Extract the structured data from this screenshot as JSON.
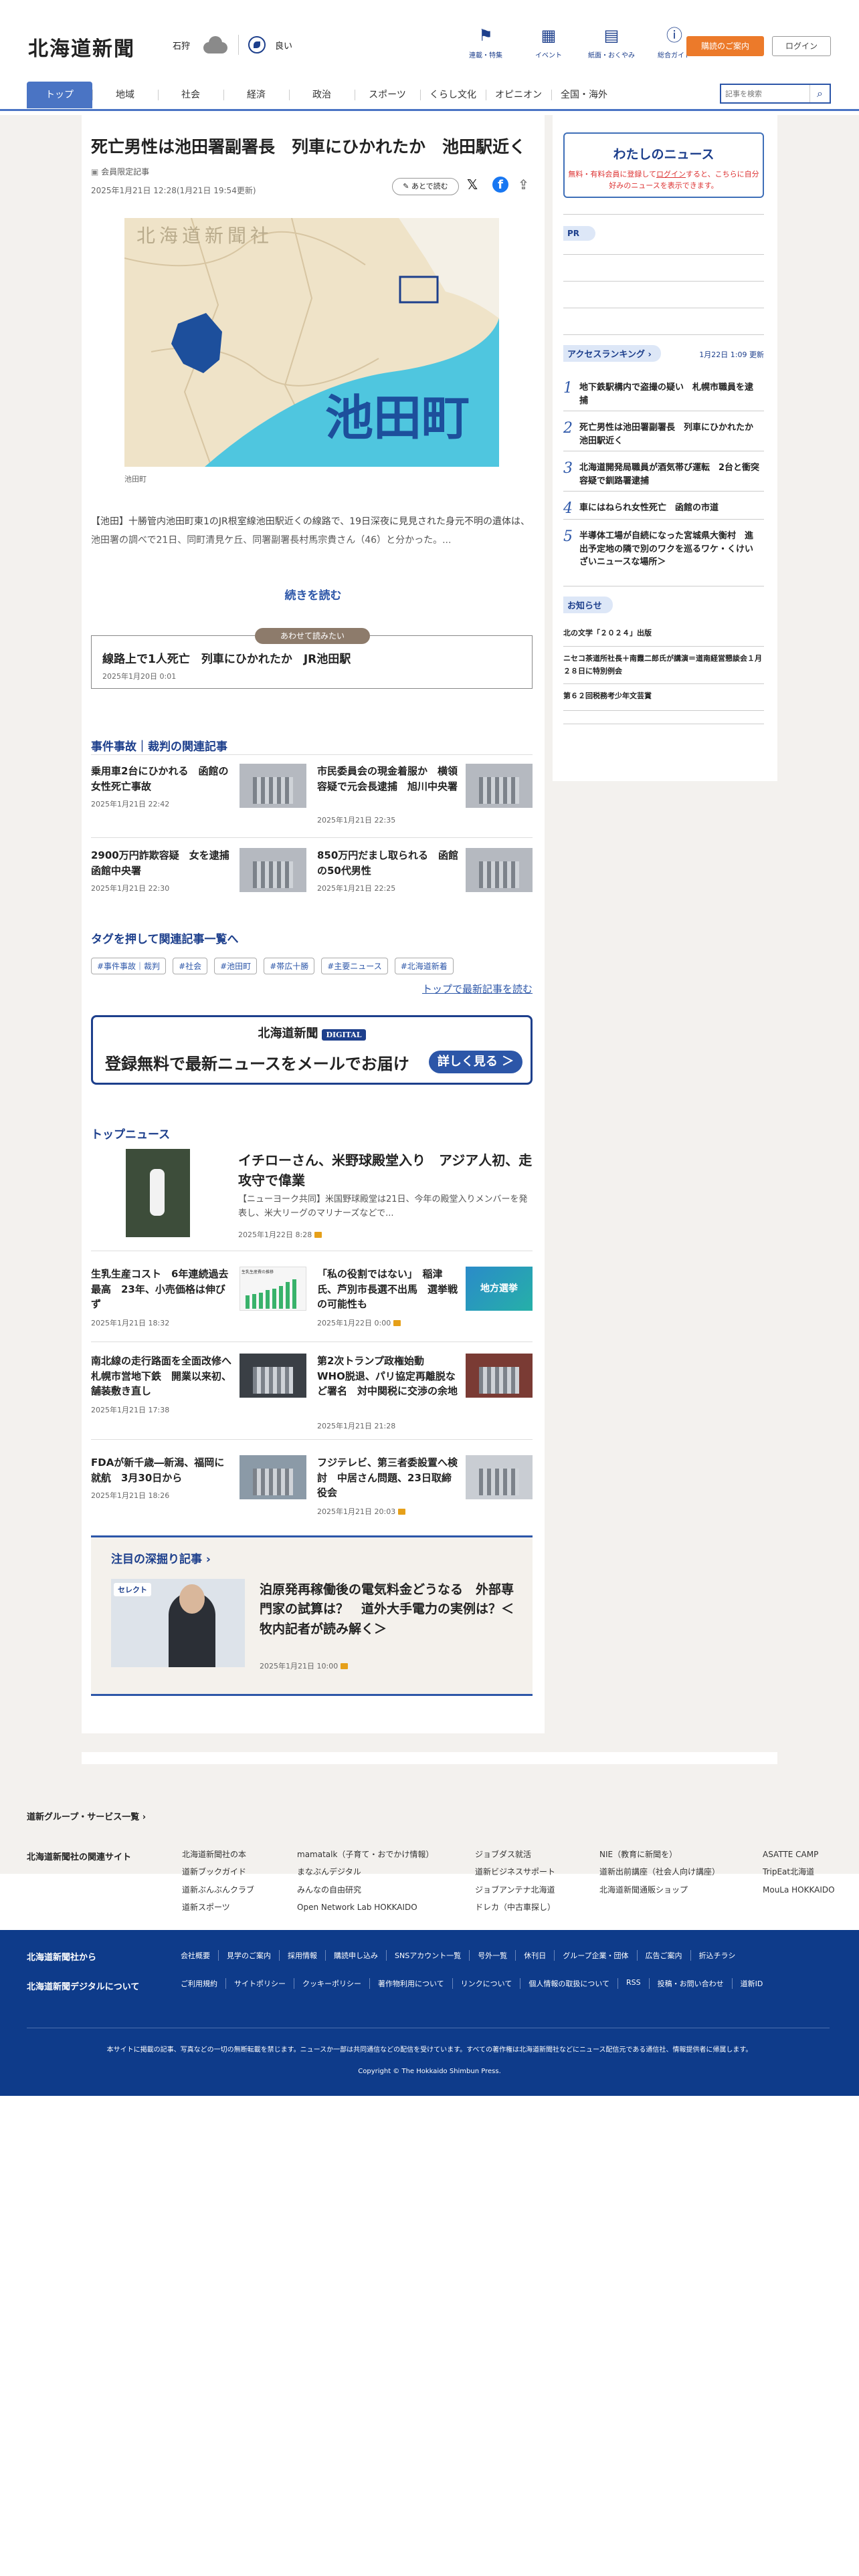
{
  "header": {
    "logo": "北海道新聞",
    "region": "石狩",
    "air": "良い",
    "icons": [
      {
        "label": "連載・特集",
        "icon": "flag-icon"
      },
      {
        "label": "イベント",
        "icon": "calendar-icon"
      },
      {
        "label": "紙面・おくやみ",
        "icon": "newspaper-icon"
      },
      {
        "label": "総合ガイド",
        "icon": "help-icon"
      }
    ],
    "subscribe": "購読のご案内",
    "login": "ログイン"
  },
  "nav": {
    "items": [
      "トップ",
      "地域",
      "社会",
      "経済",
      "政治",
      "スポーツ",
      "くらし文化",
      "オピニオン",
      "全国・海外"
    ],
    "search_placeholder": "記事を検索"
  },
  "article": {
    "title": "死亡男性は池田署副署長　列車にひかれたか　池田駅近く",
    "badge": "会員限定記事",
    "date": "2025年1月21日 12:28(1月21日 19:54更新)",
    "later": "あとで読む",
    "map_logo": "北海道新聞社",
    "map_label": "池田町",
    "caption": "池田町",
    "lead": "【池田】十勝管内池田町東1のJR根室線池田駅近くの線路で、19日深夜に見見された身元不明の遺体は、池田署の調べで21日、同町清見ケ丘、同署副署長村馬宗貴さん（46）と分かった。...",
    "more": "続きを読む"
  },
  "recommend": {
    "tag": "あわせて読みたい",
    "title": "線路上で1人死亡　列車にひかれたか　JR池田駅",
    "date": "2025年1月20日 0:01"
  },
  "related": {
    "heading": "事件事故｜裁判の関連記事",
    "items": [
      {
        "title": "乗用車2台にひかれる　函館の女性死亡事故",
        "date": "2025年1月21日 22:42"
      },
      {
        "title": "市民委員会の現金着服か　横領容疑で元会長逮捕　旭川中央署",
        "date": "2025年1月21日 22:35"
      },
      {
        "title": "2900万円詐欺容疑　女を逮捕　函館中央署",
        "date": "2025年1月21日 22:30"
      },
      {
        "title": "850万円だまし取られる　函館の50代男性",
        "date": "2025年1月21日 22:25"
      }
    ]
  },
  "tags": {
    "heading": "タグを押して関連記事一覧へ",
    "items": [
      "#事件事故｜裁判",
      "#社会",
      "#池田町",
      "#帯広十勝",
      "#主要ニュース",
      "#北海道新着"
    ],
    "latest_link": "トップで最新記事を読む"
  },
  "banner": {
    "logo": "北海道新聞",
    "digital": "DIGITAL",
    "text": "登録無料で最新ニュースをメールでお届け",
    "button": "詳しく見る ＞"
  },
  "top_news": {
    "heading": "トップニュース",
    "lead": {
      "title": "イチローさん、米野球殿堂入り　アジア人初、走攻守で偉業",
      "summary": "【ニューヨーク共同】米国野球殿堂は21日、今年の殿堂入りメンバーを発表し、米大リーグのマリナーズなどで...",
      "date": "2025年1月22日 8:28"
    },
    "items": [
      {
        "title": "生乳生産コスト　6年連続過去最高　23年、小売価格は伸びず",
        "date": "2025年1月21日 18:32"
      },
      {
        "title": "「私の役割ではない」　稲津氏、芦別市長選不出馬　選挙戦の可能性も",
        "date": "2025年1月22日 0:00",
        "badge": "地方選挙"
      },
      {
        "title": "南北線の走行路面を全面改修へ　札幌市営地下鉄　開業以来初、舗装敷き直し",
        "date": "2025年1月21日 17:38"
      },
      {
        "title": "第2次トランプ政権始動　WHO脱退、パリ協定再離脱など署名　対中関税に交渉の余地",
        "date": "2025年1月21日 21:28"
      },
      {
        "title": "FDAが新千歳―新潟、福岡に就航　3月30日から",
        "date": "2025年1月21日 18:26"
      },
      {
        "title": "フジテレビ、第三者委設置へ検討　中居さん問題、23日取締役会",
        "date": "2025年1月21日 20:03"
      }
    ],
    "chart_caption": "生乳生産費の推移"
  },
  "deep": {
    "heading": "注目の深掘り記事",
    "logo": "セレクト",
    "title": "泊原発再稼働後の電気料金どうなる　外部専門家の試算は？　道外大手電力の実例は？＜牧内記者が読み解く＞",
    "date": "2025年1月21日 10:00"
  },
  "sidebar": {
    "mynews_title": "わたしのニュース",
    "mynews_pre": "無料・有料会員に登録して",
    "mynews_link": "ログイン",
    "mynews_post": "すると、こちらに自分好みのニュースを表示できます。",
    "pr": "PR",
    "ranking_title": "アクセスランキング",
    "ranking_updated": "1月22日 1:09 更新",
    "ranking": [
      "地下鉄駅構内で盗撮の疑い　札幌市職員を逮捕",
      "死亡男性は池田署副署長　列車にひかれたか　池田駅近く",
      "北海道開発局職員が酒気帯び運転　2台と衝突　容疑で釧路署逮捕",
      "車にはねられ女性死亡　函館の市道",
      "半導体工場が自続になった宮城県大衡村　進出予定地の隣で別のワクを巡るワケ・くけいざいニュースな場所＞"
    ],
    "notice_title": "お知らせ",
    "notices": [
      "北の文学「２０２４」出版",
      "ニセコ茶道所社長＋南霞二郎氏が講演＝道南経営懇談会１月２８日に特別例会",
      "第６２回税務考少年文芸賞"
    ]
  },
  "footer": {
    "group_link": "道新グループ・サービス一覧",
    "related_title": "北海道新聞社の関連サイト",
    "related_cols": [
      [
        "北海道新聞社の本",
        "道新ブックガイド",
        "道新ぶんぶんクラブ",
        "道新スポーツ"
      ],
      [
        "mamatalk（子育て・おでかけ情報）",
        "まなぶんデジタル",
        "みんなの自由研究",
        "Open Network Lab HOKKAIDO"
      ],
      [
        "ジョブダス就活",
        "道新ビジネスサポート",
        "ジョブアンテナ北海道",
        "ドレカ（中古車探し）"
      ],
      [
        "NIE（教育に新聞を）",
        "道新出前講座（社会人向け講座）",
        "北海道新聞通販ショップ"
      ],
      [
        "ASATTE CAMP",
        "TripEat北海道",
        "MouLa HOKKAIDO"
      ]
    ],
    "from_title": "北海道新聞社から",
    "from_links": [
      "会社概要",
      "見学のご案内",
      "採用情報",
      "購読申し込み",
      "SNSアカウント一覧",
      "号外一覧",
      "休刊日",
      "グループ企業・団体",
      "広告ご案内",
      "折込チラシ"
    ],
    "about_title": "北海道新聞デジタルについて",
    "about_links": [
      "ご利用規約",
      "サイトポリシー",
      "クッキーポリシー",
      "著作物利用について",
      "リンクについて",
      "個人情報の取扱について",
      "RSS",
      "投稿・お問い合わせ",
      "道新ID"
    ],
    "note": "本サイトに掲載の記事、写真などの一切の無断転載を禁じます。ニュースか一部は共同通信などの配信を受けています。すべての著作権は北海道新聞社などにニュース配信元である通信社、情報提供者に帰属します。",
    "copyright": "Copyright © The Hokkaido Shimbun Press."
  }
}
